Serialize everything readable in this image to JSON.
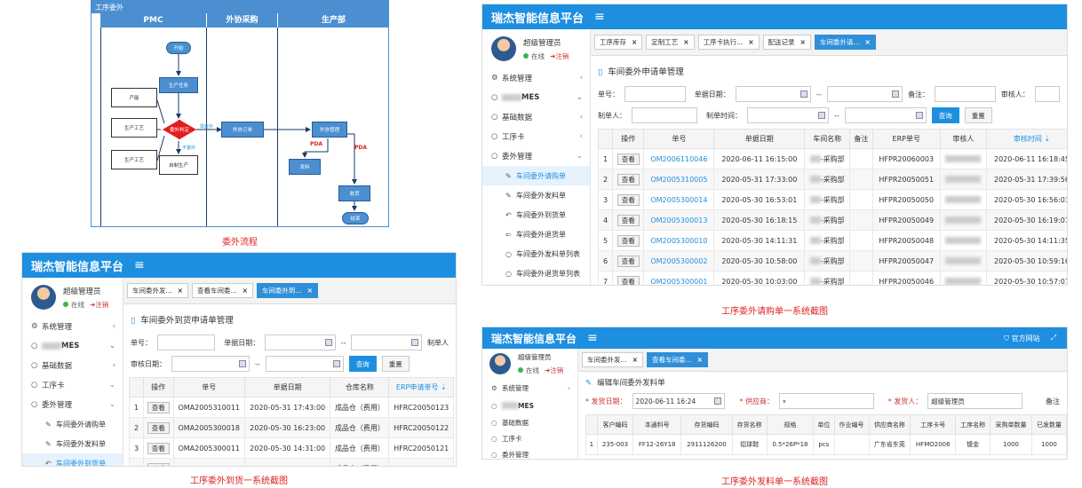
{
  "flow": {
    "title": "工序委外",
    "lanes": [
      "PMC",
      "外协采购",
      "生产部"
    ],
    "nodes": {
      "start": "开始",
      "produce_task": "生产任务",
      "decision": "委外判定",
      "outsource_order": "外协订单",
      "outsource_mgmt": "外协管理",
      "ship": "发料",
      "receive": "收货",
      "end": "结束",
      "self_produce": "自制生产",
      "doc1": "产能",
      "doc2": "生产工艺",
      "doc3": "生产工艺"
    },
    "labels": {
      "yes": "需委外",
      "no": "不委外",
      "pda1": "PDA",
      "pda2": "PDA"
    },
    "caption": "委外流程"
  },
  "app": {
    "brand": "瑞杰智能信息平台",
    "menu_icon": "≡",
    "user_name": "超级管理员",
    "status_online": "在线",
    "status_logout": "注销",
    "official_site": "官方网站"
  },
  "nav": {
    "system": "系统管理",
    "mes": "MES",
    "basic": "基础数据",
    "card": "工序卡",
    "outsource": "委外管理",
    "sub": [
      "车间委外请购单",
      "车间委外发料单",
      "车间委外到货单",
      "车间委外退货单",
      "车间委外发料单列表",
      "车间委外退货单列表"
    ]
  },
  "purchase": {
    "tabs": [
      "工序库存",
      "定制工艺",
      "工序卡执行...",
      "配送记录",
      "车间委外请..."
    ],
    "title": "车间委外申请单管理",
    "form": {
      "order_no": "单号：",
      "date": "单据日期：",
      "sep": "--",
      "remark": "备注：",
      "reviewer": "审核人：",
      "maker": "制单人：",
      "make_time": "制单时间：",
      "query": "查询",
      "reset": "重置"
    },
    "columns": [
      "",
      "操作",
      "单号",
      "单据日期",
      "车间名称",
      "备注",
      "ERP单号",
      "审核人",
      "审核时间"
    ],
    "view": "查看",
    "rows": [
      [
        "1",
        "OM2006110046",
        "2020-06-11 16:15:00",
        "-采购部",
        "HFPR20060003",
        "2020-06-11 16:18:45"
      ],
      [
        "2",
        "OM2005310005",
        "2020-05-31 17:33:00",
        "-采购部",
        "HFPR20050051",
        "2020-05-31 17:39:56"
      ],
      [
        "3",
        "OM2005300014",
        "2020-05-30 16:53:01",
        "-采购部",
        "HFPR20050050",
        "2020-05-30 16:56:03"
      ],
      [
        "4",
        "OM2005300013",
        "2020-05-30 16:18:15",
        "-采购部",
        "HFPR20050049",
        "2020-05-30 16:19:07"
      ],
      [
        "5",
        "OM2005300010",
        "2020-05-30 14:11:31",
        "-采购部",
        "HFPR20050048",
        "2020-05-30 14:11:35"
      ],
      [
        "6",
        "OM2005300002",
        "2020-05-30 10:58:00",
        "-采购部",
        "HFPR20050047",
        "2020-05-30 10:59:16"
      ],
      [
        "7",
        "OM2005300001",
        "2020-05-30 10:03:00",
        "-采购部",
        "HFPR20050046",
        "2020-05-30 10:57:07"
      ]
    ],
    "caption": "工序委外请购单一系统截图"
  },
  "arrival": {
    "tabs": [
      "车间委外发...",
      "查看车间委...",
      "车间委外到..."
    ],
    "title": "车间委外到货申请单管理",
    "form": {
      "order_no": "单号：",
      "date": "单据日期：",
      "sep": "--",
      "maker": "制单人",
      "review_date": "审核日期：",
      "query": "查询",
      "reset": "重置"
    },
    "columns": [
      "",
      "操作",
      "单号",
      "单据日期",
      "仓库名称",
      "ERP申请单号"
    ],
    "view": "查看",
    "rows": [
      [
        "1",
        "OMA2005310011",
        "2020-05-31 17:43:00",
        "成品仓（费用）",
        "HFRC20050123"
      ],
      [
        "2",
        "OMA2005300018",
        "2020-05-30 16:23:00",
        "成品仓（费用）",
        "HFRC20050122"
      ],
      [
        "3",
        "OMA2005300011",
        "2020-05-30 14:31:00",
        "成品仓（费用）",
        "HFRC20050121"
      ],
      [
        "4",
        "OMA2005300010",
        "2020-05-30 11:41:00",
        "成品仓（费用）",
        "HFRC20050115"
      ]
    ],
    "caption": "工序委外到货一系统截图"
  },
  "issue": {
    "tabs": [
      "车间委外发...",
      "查看车间委..."
    ],
    "title": "编辑车间委外发料单",
    "form": {
      "date_label": "* 发货日期：",
      "date_value": "2020-06-11 16:24",
      "supplier": "* 供应商：",
      "sender": "* 发货人：",
      "sender_value": "超级管理员",
      "remark": "备注"
    },
    "columns": [
      "",
      "客户编码",
      "本通料号",
      "存货编码",
      "存货名称",
      "规格",
      "单位",
      "作业编号",
      "供应商名称",
      "工序卡号",
      "工序名称",
      "采购单数量",
      "已发数量"
    ],
    "row": [
      "1",
      "235-003",
      "FF12-26Y18",
      "2911126200",
      "铝球鞋",
      "0.5*26P*18",
      "pcs",
      "",
      "广东省东莞",
      "HFMO2006",
      "镀金",
      "1000",
      "1000"
    ],
    "caption": "工序委外发料单一系统截图"
  }
}
